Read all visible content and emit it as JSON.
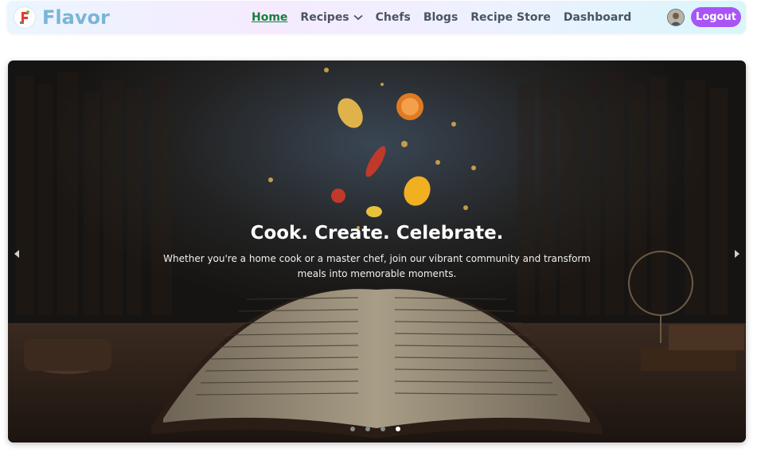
{
  "brand": {
    "name": "Flavor",
    "logo_icon": "flavor-logo-icon"
  },
  "nav": {
    "links": [
      {
        "label": "Home",
        "active": true
      },
      {
        "label": "Recipes",
        "has_dropdown": true
      },
      {
        "label": "Chefs"
      },
      {
        "label": "Blogs"
      },
      {
        "label": "Recipe Store"
      },
      {
        "label": "Dashboard"
      }
    ],
    "dropdown_icon": "chevron-down-icon",
    "active_color": "#15803d"
  },
  "user": {
    "avatar_icon": "user-avatar",
    "logout_label": "Logout",
    "logout_color": "#a855f7"
  },
  "hero": {
    "title": "Cook. Create. Celebrate.",
    "subtitle": "Whether you're a home cook or a master chef, join our vibrant community and transform meals into memorable moments.",
    "image_icon": "open-book-with-floating-ingredients-image",
    "prev_icon": "arrow-left-icon",
    "next_icon": "arrow-right-icon",
    "slide_count": 4,
    "active_slide": 4
  }
}
